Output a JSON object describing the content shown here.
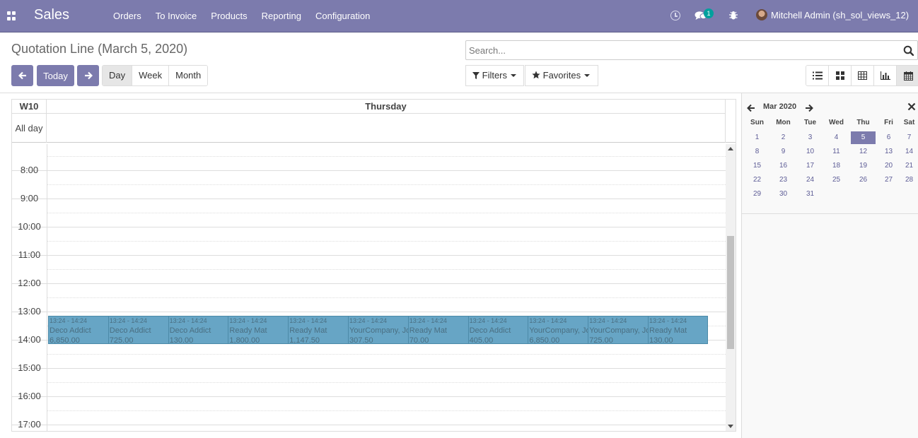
{
  "navbar": {
    "brand": "Sales",
    "menu": [
      "Orders",
      "To Invoice",
      "Products",
      "Reporting",
      "Configuration"
    ],
    "chat_count": "1",
    "user": "Mitchell Admin (sh_sol_views_12)"
  },
  "control": {
    "title": "Quotation Line (March 5, 2020)",
    "search_placeholder": "Search...",
    "today_label": "Today",
    "scales": [
      "Day",
      "Week",
      "Month"
    ],
    "active_scale": "Day",
    "filters_label": "Filters",
    "favorites_label": "Favorites"
  },
  "calendar": {
    "week_label": "W10",
    "day_name": "Thursday",
    "all_day_label": "All day",
    "hours": [
      "8:00",
      "9:00",
      "10:00",
      "11:00",
      "12:00",
      "13:00",
      "14:00",
      "15:00",
      "16:00",
      "17:00"
    ],
    "events": [
      {
        "time": "13:24 - 14:24",
        "partner": "Deco Addict",
        "amount": "6,850.00"
      },
      {
        "time": "13:24 - 14:24",
        "partner": "Deco Addict",
        "amount": "725.00"
      },
      {
        "time": "13:24 - 14:24",
        "partner": "Deco Addict",
        "amount": "130.00"
      },
      {
        "time": "13:24 - 14:24",
        "partner": "Ready Mat",
        "amount": "1,800.00"
      },
      {
        "time": "13:24 - 14:24",
        "partner": "Ready Mat",
        "amount": "1,147.50"
      },
      {
        "time": "13:24 - 14:24",
        "partner": "YourCompany, Jo",
        "amount": "307.50"
      },
      {
        "time": "13:24 - 14:24",
        "partner": "Ready Mat",
        "amount": "70.00"
      },
      {
        "time": "13:24 - 14:24",
        "partner": "Deco Addict",
        "amount": "405.00"
      },
      {
        "time": "13:24 - 14:24",
        "partner": "YourCompany, Jo",
        "amount": "6,850.00"
      },
      {
        "time": "13:24 - 14:24",
        "partner": "YourCompany, Jo",
        "amount": "725.00"
      },
      {
        "time": "13:24 - 14:24",
        "partner": "Ready Mat",
        "amount": "130.00"
      }
    ],
    "event_color": "#67a5c5"
  },
  "mini_calendar": {
    "title": "Mar 2020",
    "days_of_week": [
      "Sun",
      "Mon",
      "Tue",
      "Wed",
      "Thu",
      "Fri",
      "Sat"
    ],
    "weeks": [
      [
        "1",
        "2",
        "3",
        "4",
        "5",
        "6",
        "7"
      ],
      [
        "8",
        "9",
        "10",
        "11",
        "12",
        "13",
        "14"
      ],
      [
        "15",
        "16",
        "17",
        "18",
        "19",
        "20",
        "21"
      ],
      [
        "22",
        "23",
        "24",
        "25",
        "26",
        "27",
        "28"
      ],
      [
        "29",
        "30",
        "31"
      ]
    ],
    "selected_day": "5"
  },
  "colors": {
    "brand": "#7c7bad",
    "badge": "#00a09d"
  }
}
